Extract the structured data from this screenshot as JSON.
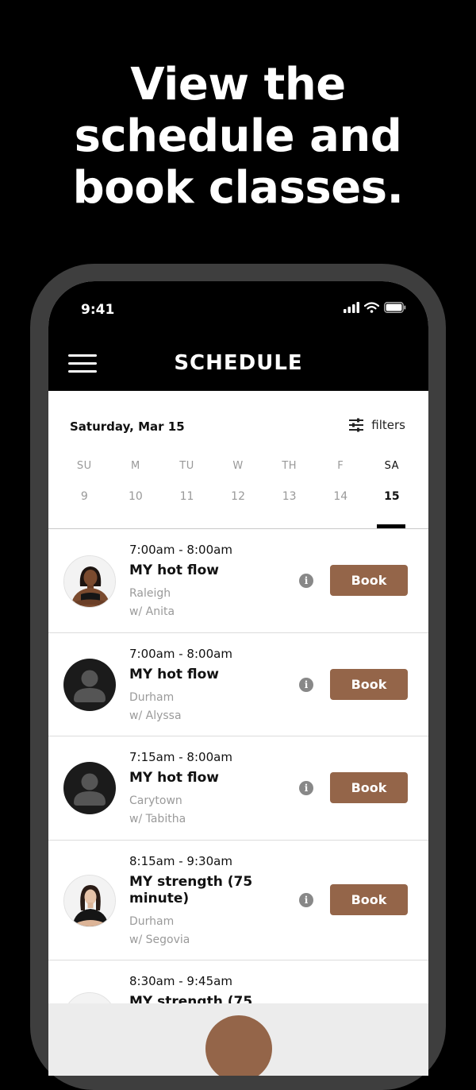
{
  "headline": [
    "View the",
    "schedule and",
    "book classes."
  ],
  "status_bar": {
    "time": "9:41"
  },
  "header": {
    "title": "SCHEDULE"
  },
  "date_header": {
    "date": "Saturday, Mar 15",
    "filters_label": "filters"
  },
  "week": {
    "days": [
      "SU",
      "M",
      "TU",
      "W",
      "TH",
      "F",
      "SA"
    ],
    "dates": [
      "9",
      "10",
      "11",
      "12",
      "13",
      "14",
      "15"
    ],
    "selected_index": 6
  },
  "classes": [
    {
      "time": "7:00am - 8:00am",
      "name": "MY hot flow",
      "location": "Raleigh",
      "instructor": "w/ Anita",
      "avatar": "photo",
      "book_label": "Book"
    },
    {
      "time": "7:00am - 8:00am",
      "name": "MY hot flow",
      "location": "Durham",
      "instructor": "w/ Alyssa",
      "avatar": "generic",
      "book_label": "Book"
    },
    {
      "time": "7:15am - 8:00am",
      "name": "MY hot flow",
      "location": "Carytown",
      "instructor": "w/ Tabitha",
      "avatar": "generic",
      "book_label": "Book"
    },
    {
      "time": "8:15am - 9:30am",
      "name": "MY strength (75 minute)",
      "location": "Durham",
      "instructor": "w/ Segovia",
      "avatar": "photo",
      "book_label": "Book"
    },
    {
      "time": "8:30am - 9:45am",
      "name": "MY strength (75",
      "location": "",
      "instructor": "",
      "avatar": "photo",
      "book_label": ""
    }
  ],
  "colors": {
    "accent": "#946549",
    "background": "#000000",
    "frame": "#3e3e3e",
    "info_icon": "#888888"
  },
  "icons": [
    "hamburger-menu-icon",
    "filters-sliders-icon",
    "signal-icon",
    "wifi-icon",
    "battery-icon",
    "info-icon",
    "person-icon"
  ]
}
